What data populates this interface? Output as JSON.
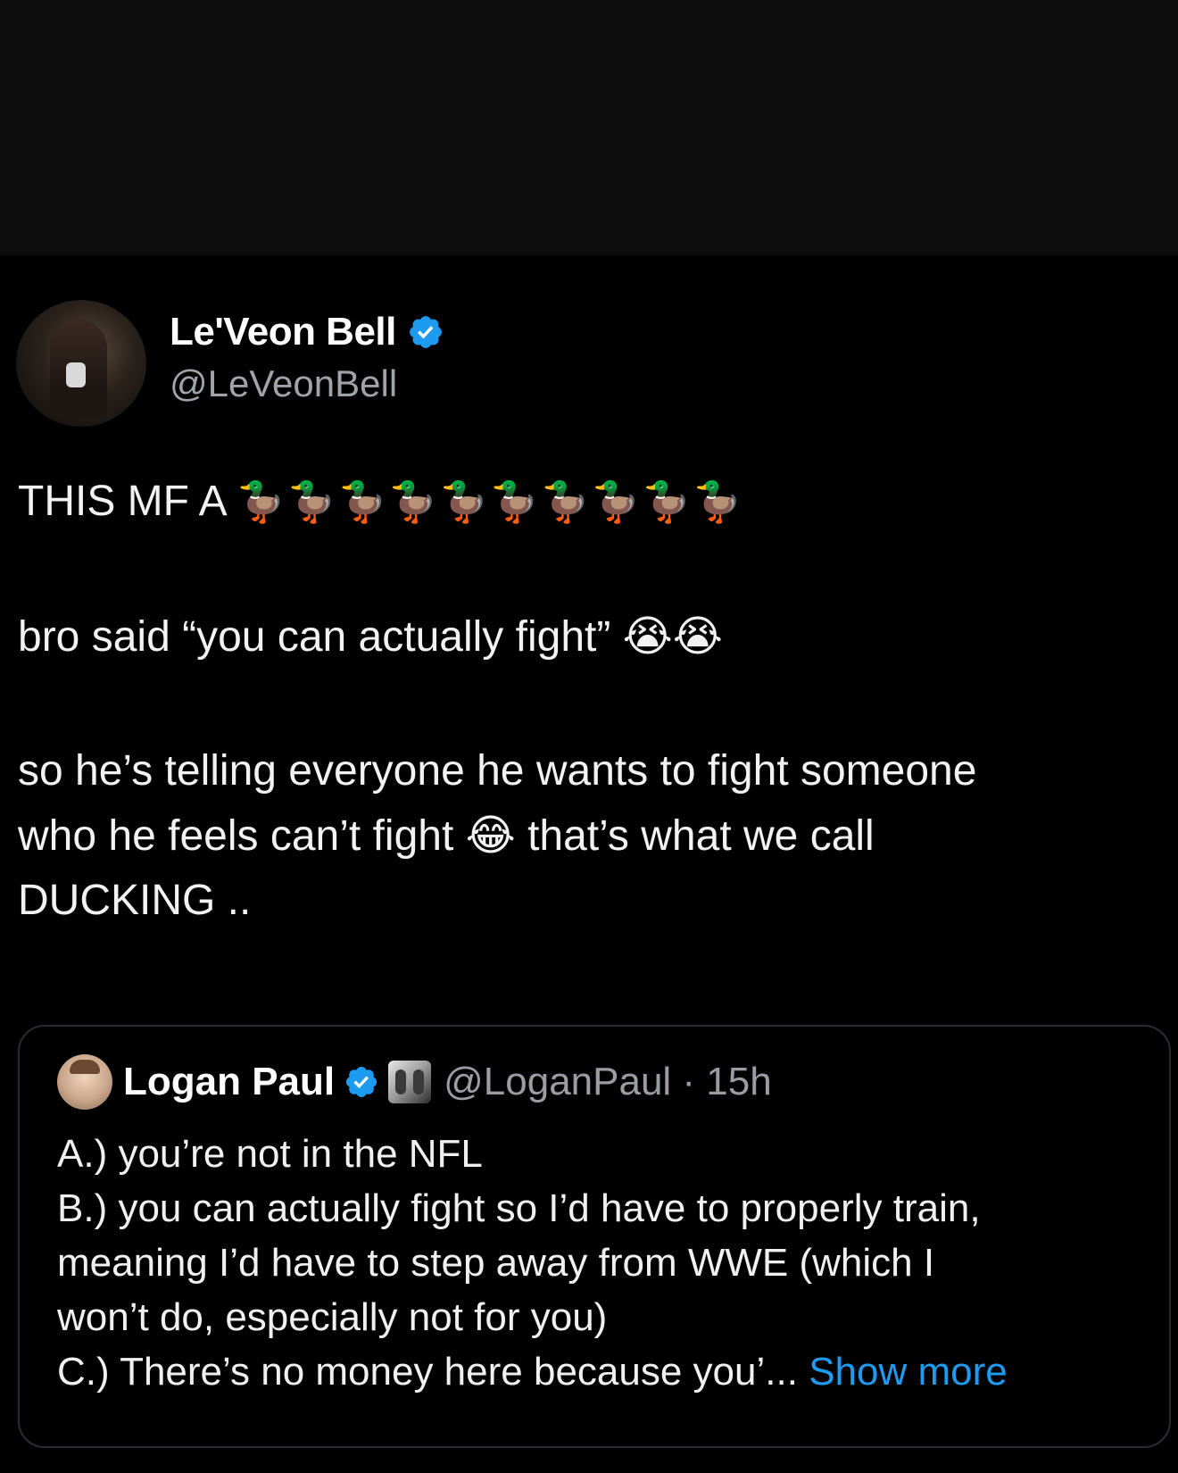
{
  "tweet": {
    "author": {
      "display_name": "Le'Veon Bell",
      "handle": "@LeVeonBell",
      "verified": true
    },
    "lines": [
      {
        "text": "THIS MF A ",
        "emoji": "🦆🦆🦆🦆🦆🦆🦆🦆🦆🦆"
      },
      {
        "text": "bro said “you can actually fight” ",
        "emoji": "😭😭"
      },
      {
        "text": "so he’s telling everyone he wants to fight someone"
      },
      {
        "text": "who he feels can’t fight ",
        "emoji": "😂",
        "after": " that’s what we call"
      },
      {
        "text": "DUCKING .."
      }
    ]
  },
  "quoted_tweet": {
    "author": {
      "display_name": "Logan Paul",
      "handle_time": "@LoganPaul · 15h",
      "verified": true
    },
    "lines": [
      "A.) you’re not in the NFL",
      "B.) you can actually fight so I’d have to properly train,",
      "meaning I’d have to step away from WWE (which I",
      "won’t do, especially not for you)",
      "C.) There’s no money here because you’..."
    ],
    "show_more_label": "Show more"
  },
  "colors": {
    "background": "#000000",
    "top_band": "#0d0d0d",
    "text": "#e7e9ea",
    "secondary_text": "#a0a4a8",
    "link": "#1d9bf0",
    "verified_badge": "#1d9bf0",
    "quote_border": "#2a2d30"
  },
  "icons": {
    "verified": "verified-badge-icon",
    "affiliate": "affiliate-badge-icon"
  }
}
